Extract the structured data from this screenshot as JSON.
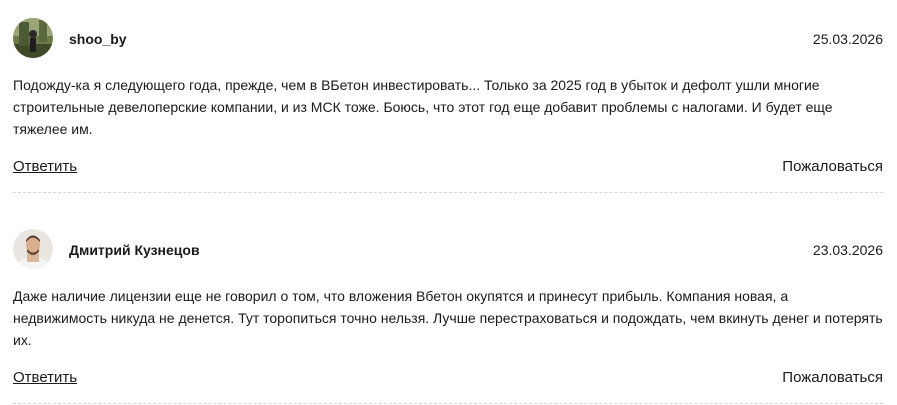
{
  "comments": [
    {
      "author": "shoo_by",
      "date": "25.03.2026",
      "text": "Подожду-ка я следующего года, прежде, чем в ВБетон инвестировать... Только за 2025 год в убыток и дефолт ушли многие строительные девелоперские компании, и из МСК тоже. Боюсь, что этот год еще добавит проблемы с налогами. И будет еще тяжелее им.",
      "reply_label": "Ответить",
      "report_label": "Пожаловаться",
      "avatar_icon": "user-photo-icon"
    },
    {
      "author": "Дмитрий Кузнецов",
      "date": "23.03.2026",
      "text": "Даже наличие лицензии еще не говорил о том, что вложения Вбетон окупятся и принесут прибыль. Компания новая, а недвижимость никуда не денется. Тут торопиться точно нельзя. Лучше перестраховаться и подождать, чем вкинуть денег и потерять их.",
      "reply_label": "Ответить",
      "report_label": "Пожаловаться",
      "avatar_icon": "user-photo-icon"
    }
  ]
}
